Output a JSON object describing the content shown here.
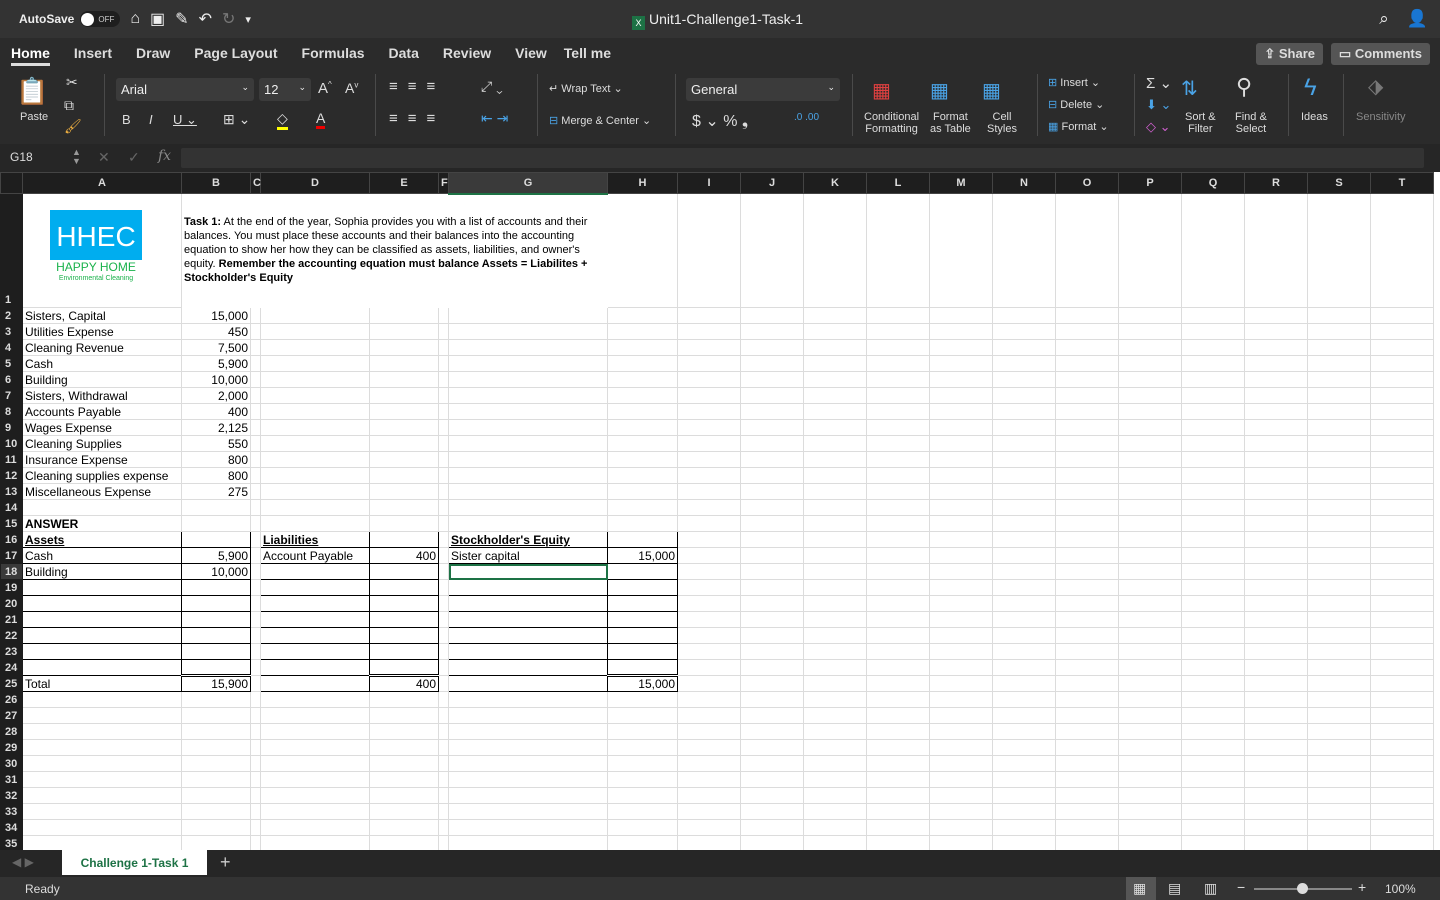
{
  "titlebar": {
    "autosave": "AutoSave",
    "toggle": "OFF",
    "title": "Unit1-Challenge1-Task-1"
  },
  "tabs": [
    "Home",
    "Insert",
    "Draw",
    "Page Layout",
    "Formulas",
    "Data",
    "Review",
    "View",
    "Tell me"
  ],
  "share": "Share",
  "comments": "Comments",
  "ribbon": {
    "paste": "Paste",
    "font": "Arial",
    "size": "12",
    "wrap": "Wrap Text",
    "merge": "Merge & Center",
    "number_format": "General",
    "cond1": "Conditional",
    "cond2": "Formatting",
    "fmt1": "Format",
    "fmt2": "as Table",
    "cell1": "Cell",
    "cell2": "Styles",
    "insert": "Insert",
    "delete": "Delete",
    "format": "Format",
    "sort1": "Sort &",
    "sort2": "Filter",
    "find1": "Find &",
    "find2": "Select",
    "ideas": "Ideas",
    "sensitivity": "Sensitivity"
  },
  "formula_bar": {
    "name_box": "G18",
    "formula": ""
  },
  "columns": [
    "A",
    "B",
    "C",
    "D",
    "E",
    "F",
    "G",
    "H",
    "I",
    "J",
    "K",
    "L",
    "M",
    "N",
    "O",
    "P",
    "Q",
    "R",
    "S",
    "T"
  ],
  "logo": {
    "mark": "HHEC",
    "name": "HAPPY HOME",
    "tagline": "Environmental Cleaning"
  },
  "task": {
    "lead": "Task 1:",
    "body": " At the end of the year, Sophia provides you with a list of accounts and their balances. You must place these accounts and their balances into the accounting equation to show her how they can be classified as assets, liabilities, and owner's equity. ",
    "emphasis": "Remember the accounting equation must balance Assets = Liabilites + Stockholder's Equity"
  },
  "rows": {
    "2": {
      "A": "Sisters, Capital",
      "B": "15,000"
    },
    "3": {
      "A": "Utilities Expense",
      "B": "450"
    },
    "4": {
      "A": "Cleaning Revenue",
      "B": "7,500"
    },
    "5": {
      "A": "Cash",
      "B": "5,900"
    },
    "6": {
      "A": "Building",
      "B": "10,000"
    },
    "7": {
      "A": "Sisters, Withdrawal",
      "B": "2,000"
    },
    "8": {
      "A": "Accounts Payable",
      "B": "400"
    },
    "9": {
      "A": "Wages Expense",
      "B": "2,125"
    },
    "10": {
      "A": "Cleaning Supplies",
      "B": "550"
    },
    "11": {
      "A": "Insurance Expense",
      "B": "800"
    },
    "12": {
      "A": "Cleaning supplies expense",
      "B": "800"
    },
    "13": {
      "A": "Miscellaneous Expense",
      "B": "275"
    },
    "15": {
      "A": "ANSWER"
    },
    "16": {
      "A": "Assets",
      "D": "Liabilities",
      "G": "Stockholder's Equity"
    },
    "17": {
      "A": "Cash",
      "B": "5,900",
      "D": "Account Payable",
      "E": "400",
      "G": "Sister capital",
      "H": "15,000"
    },
    "18": {
      "A": "Building",
      "B": "10,000"
    },
    "25": {
      "A": "Total",
      "B": "15,900",
      "E": "400",
      "H": "15,000"
    }
  },
  "sheet_tab": "Challenge 1-Task 1",
  "status": {
    "ready": "Ready",
    "zoom": "100%"
  },
  "colors": {
    "excel_green": "#1d7245",
    "logo_blue": "#00adef"
  }
}
